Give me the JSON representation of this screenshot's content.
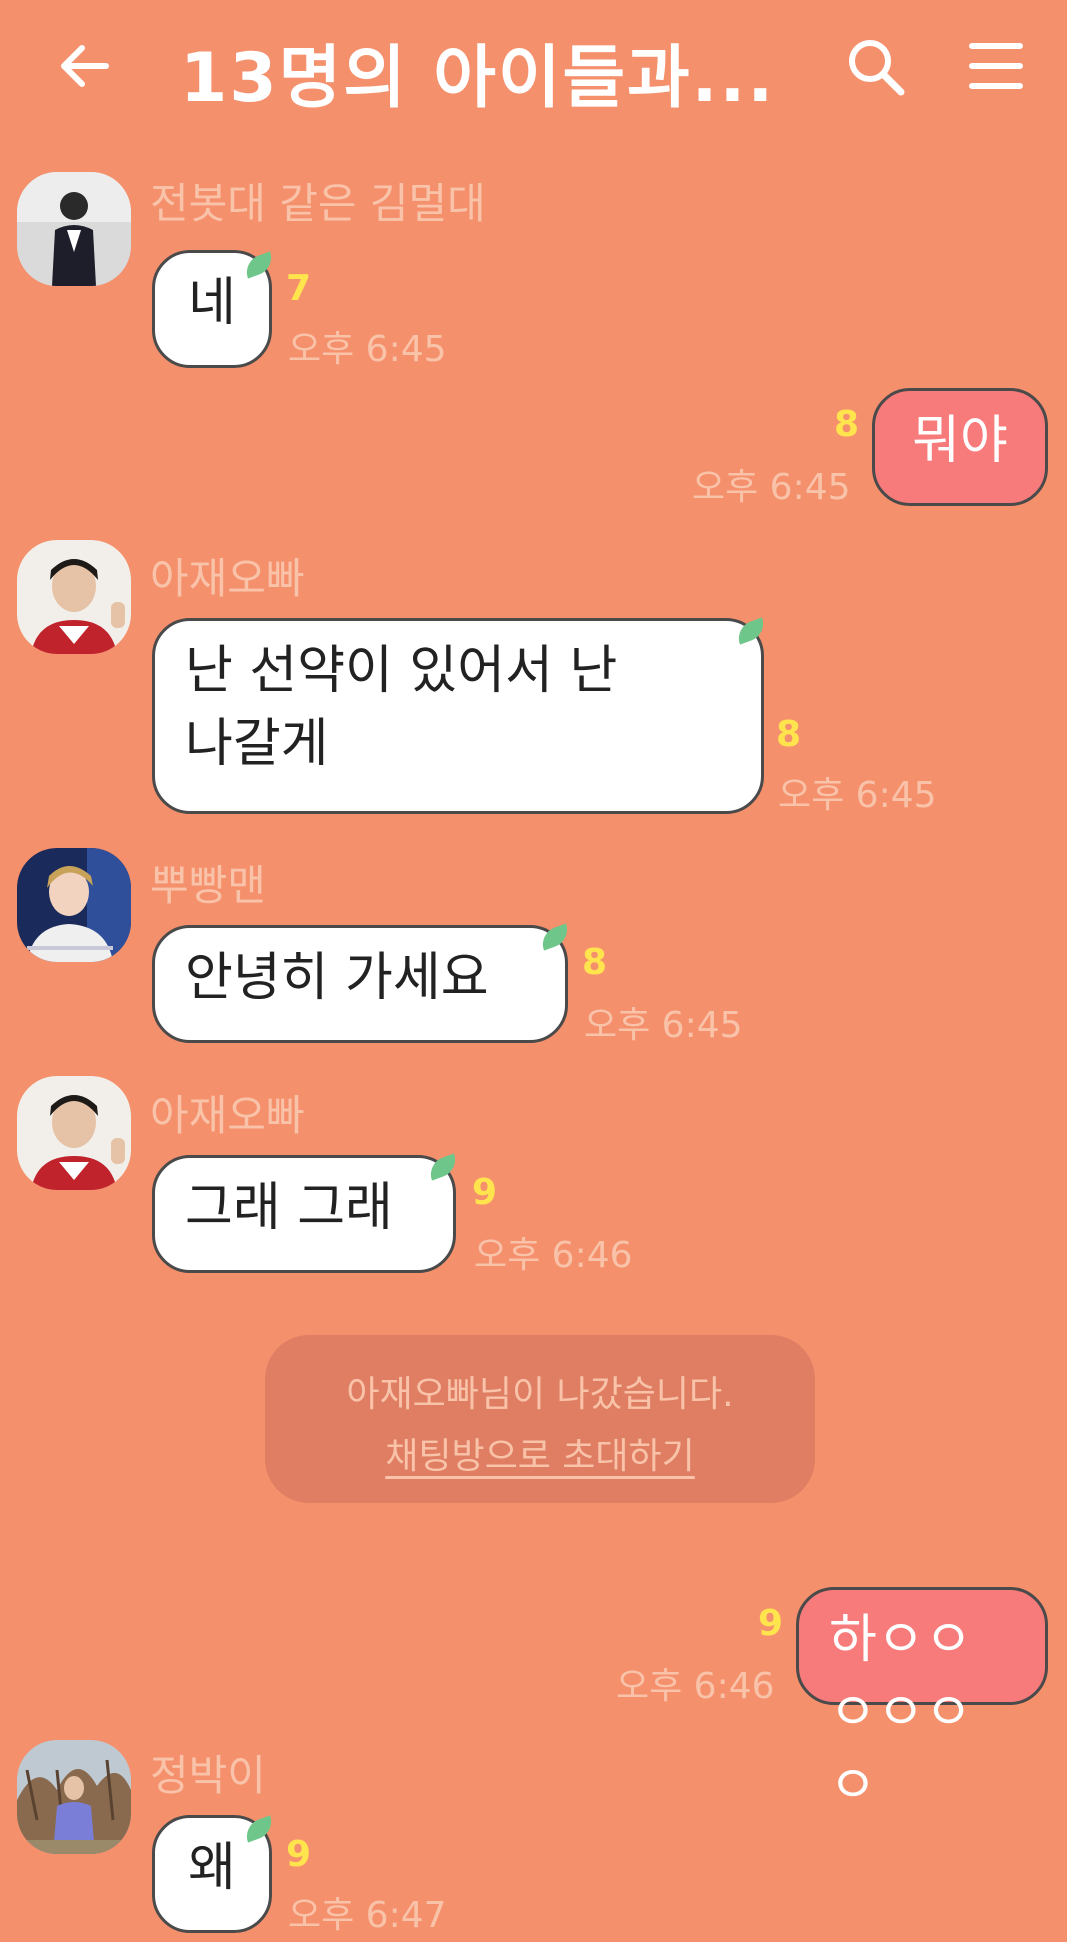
{
  "header": {
    "title": "13명의 아이들과...",
    "back_icon": "back-arrow-icon",
    "search_icon": "search-icon",
    "menu_icon": "hamburger-menu-icon"
  },
  "colors": {
    "background": "#F5906D",
    "my_bubble": "#F87B7B",
    "other_bubble": "#FFFFFF",
    "unread": "#FFE44D",
    "muted_text": "#F9C3A9",
    "system_box": "#DF7E63"
  },
  "messages": [
    {
      "sender": "전봇대 같은 김멀대",
      "text": "네",
      "unread": "7",
      "time": "오후 6:45"
    },
    {
      "sender": "",
      "text": "뭐야",
      "unread": "8",
      "time": "오후 6:45"
    },
    {
      "sender": "아재오빠",
      "text": "난 선약이 있어서 난 나갈게",
      "unread": "8",
      "time": "오후 6:45"
    },
    {
      "sender": "뿌빵맨",
      "text": "안녕히 가세요",
      "unread": "8",
      "time": "오후 6:45"
    },
    {
      "sender": "아재오빠",
      "text": "그래 그래",
      "unread": "9",
      "time": "오후 6:46"
    },
    {
      "sender": "",
      "text": "하ㅇㅇㅇㅇㅇㅇ",
      "unread": "9",
      "time": "오후 6:46"
    },
    {
      "sender": "정박이",
      "text": "왜",
      "unread": "9",
      "time": "오후 6:47"
    }
  ],
  "system": {
    "notice": "아재오빠님이 나갔습니다.",
    "invite_link": "채팅방으로 초대하기"
  }
}
